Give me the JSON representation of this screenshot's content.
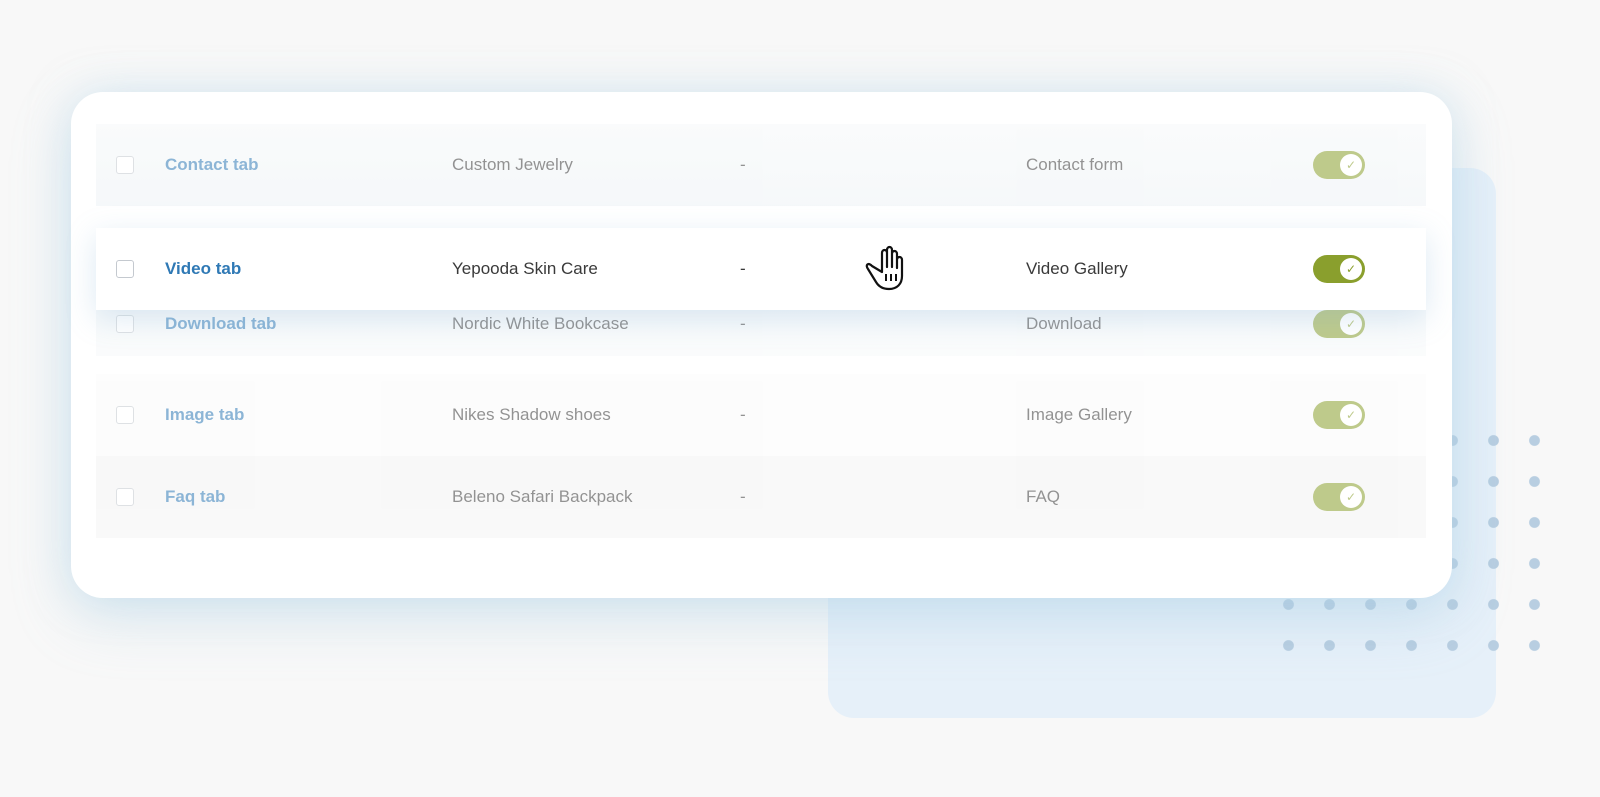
{
  "colors": {
    "accent_link": "#2f79b5",
    "toggle_on": "#8a9f2d",
    "background_panel": "#e6f0f9"
  },
  "rows": [
    {
      "name": "Contact tab",
      "product": "Custom Jewelry",
      "dash": "-",
      "type": "Contact form",
      "enabled": true,
      "state": "dimmed"
    },
    {
      "name": "Video tab",
      "product": "Yepooda Skin Care",
      "dash": "-",
      "type": "Video Gallery",
      "enabled": true,
      "state": "dragging"
    },
    {
      "name": "Download tab",
      "product": "Nordic White Bookcase",
      "dash": "-",
      "type": "Download",
      "enabled": true,
      "state": "dimmed"
    },
    {
      "name": "Image tab",
      "product": "Nikes Shadow shoes",
      "dash": "-",
      "type": "Image Gallery",
      "enabled": true,
      "state": "dimmed"
    },
    {
      "name": "Faq tab",
      "product": "Beleno Safari Backpack",
      "dash": "-",
      "type": "FAQ",
      "enabled": true,
      "state": "dimmed"
    }
  ],
  "icons": {
    "toggle_check": "checkmark-icon",
    "cursor": "grab-hand-cursor-icon"
  }
}
